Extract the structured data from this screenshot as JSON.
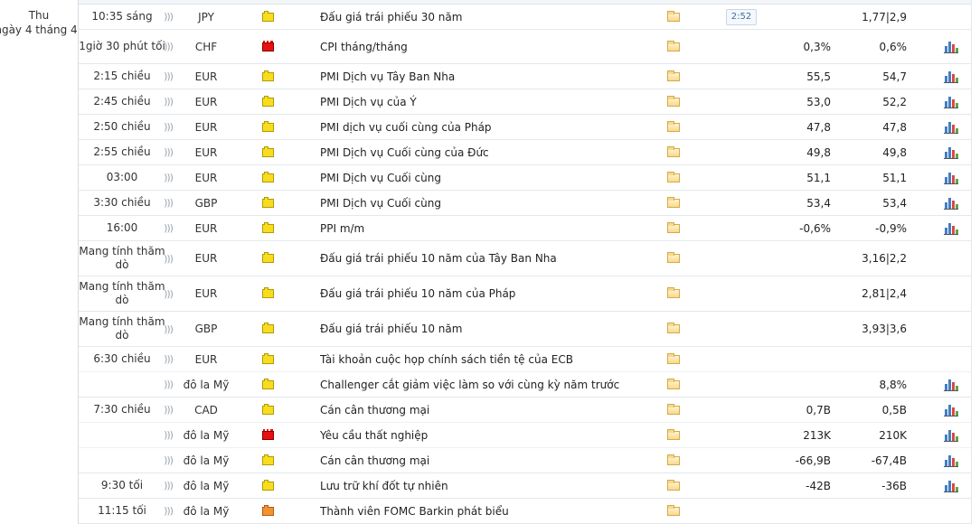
{
  "day": {
    "weekday": "Thu",
    "date": "ngày 4 tháng 4"
  },
  "timer": "2:52",
  "rows": [
    {
      "time": "10:35 sáng",
      "sound": ")))",
      "currency": "JPY",
      "importance": "yellow",
      "event": "Đấu giá trái phiếu 30 năm",
      "actual": "",
      "forecast": "1,77|2,9",
      "chart": false,
      "timer": true
    },
    {
      "time": "1giờ 30 phút tối",
      "sound": ")))",
      "currency": "CHF",
      "importance": "red",
      "event": "CPI tháng/tháng",
      "actual": "0,3%",
      "forecast": "0,6%",
      "chart": true
    },
    {
      "time": "2:15 chiều",
      "sound": ")))",
      "currency": "EUR",
      "importance": "yellow",
      "event": "PMI Dịch vụ Tây Ban Nha",
      "actual": "55,5",
      "forecast": "54,7",
      "chart": true
    },
    {
      "time": "2:45 chiều",
      "sound": ")))",
      "currency": "EUR",
      "importance": "yellow",
      "event": "PMI Dịch vụ của Ý",
      "actual": "53,0",
      "forecast": "52,2",
      "chart": true
    },
    {
      "time": "2:50 chiều",
      "sound": ")))",
      "currency": "EUR",
      "importance": "yellow",
      "event": "PMI dịch vụ cuối cùng của Pháp",
      "actual": "47,8",
      "forecast": "47,8",
      "chart": true
    },
    {
      "time": "2:55 chiều",
      "sound": ")))",
      "currency": "EUR",
      "importance": "yellow",
      "event": "PMI Dịch vụ Cuối cùng của Đức",
      "actual": "49,8",
      "forecast": "49,8",
      "chart": true
    },
    {
      "time": "03:00",
      "sound": ")))",
      "currency": "EUR",
      "importance": "yellow",
      "event": "PMI Dịch vụ Cuối cùng",
      "actual": "51,1",
      "forecast": "51,1",
      "chart": true
    },
    {
      "time": "3:30 chiều",
      "sound": ")))",
      "currency": "GBP",
      "importance": "yellow",
      "event": "PMI Dịch vụ Cuối cùng",
      "actual": "53,4",
      "forecast": "53,4",
      "chart": true
    },
    {
      "time": "16:00",
      "sound": ")))",
      "currency": "EUR",
      "importance": "yellow",
      "event": "PPI m/m",
      "actual": "-0,6%",
      "forecast": "-0,9%",
      "chart": true
    },
    {
      "time": "Mang tính thăm dò",
      "sound": ")))",
      "currency": "EUR",
      "importance": "yellow",
      "event": "Đấu giá trái phiếu 10 năm của Tây Ban Nha",
      "actual": "",
      "forecast": "3,16|2,2",
      "chart": false
    },
    {
      "time": "Mang tính thăm dò",
      "sound": ")))",
      "currency": "EUR",
      "importance": "yellow",
      "event": "Đấu giá trái phiếu 10 năm của Pháp",
      "actual": "",
      "forecast": "2,81|2,4",
      "chart": false
    },
    {
      "time": "Mang tính thăm dò",
      "sound": ")))",
      "currency": "GBP",
      "importance": "yellow",
      "event": "Đấu giá trái phiếu 10 năm",
      "actual": "",
      "forecast": "3,93|3,6",
      "chart": false
    },
    {
      "time": "6:30 chiều",
      "sound": ")))",
      "currency": "EUR",
      "importance": "yellow",
      "event": "Tài khoản cuộc họp chính sách tiền tệ của ECB",
      "actual": "",
      "forecast": "",
      "chart": false
    },
    {
      "time": "",
      "sound": ")))",
      "currency": "đô la Mỹ",
      "importance": "yellow",
      "event": "Challenger cắt giảm việc làm so với cùng kỳ năm trước",
      "actual": "",
      "forecast": "8,8%",
      "chart": true
    },
    {
      "time": "7:30 chiều",
      "sound": ")))",
      "currency": "CAD",
      "importance": "yellow",
      "event": "Cán cân thương mại",
      "actual": "0,7B",
      "forecast": "0,5B",
      "chart": true
    },
    {
      "time": "",
      "sound": ")))",
      "currency": "đô la Mỹ",
      "importance": "red",
      "event": "Yêu cầu thất nghiệp",
      "actual": "213K",
      "forecast": "210K",
      "chart": true
    },
    {
      "time": "",
      "sound": ")))",
      "currency": "đô la Mỹ",
      "importance": "yellow",
      "event": "Cán cân thương mại",
      "actual": "-66,9B",
      "forecast": "-67,4B",
      "chart": true
    },
    {
      "time": "9:30 tối",
      "sound": ")))",
      "currency": "đô la Mỹ",
      "importance": "yellow",
      "event": "Lưu trữ khí đốt tự nhiên",
      "actual": "-42B",
      "forecast": "-36B",
      "chart": true
    },
    {
      "time": "11:15 tối",
      "sound": ")))",
      "currency": "đô la Mỹ",
      "importance": "orange",
      "event": "Thành viên FOMC Barkin phát biểu",
      "actual": "",
      "forecast": "",
      "chart": false
    }
  ]
}
